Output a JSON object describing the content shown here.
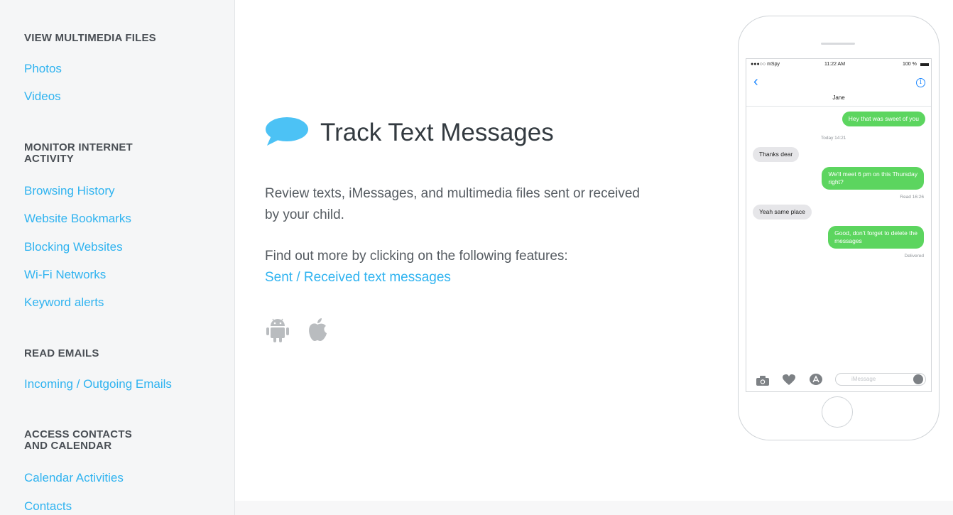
{
  "sidebar": {
    "sections": [
      {
        "title": "VIEW MULTIMEDIA FILES",
        "links": [
          "Photos",
          "Videos"
        ]
      },
      {
        "title": "MONITOR INTERNET\nACTIVITY",
        "links": [
          "Browsing History",
          "Website Bookmarks",
          "Blocking Websites",
          "Wi-Fi Networks",
          "Keyword alerts"
        ]
      },
      {
        "title": "READ EMAILS",
        "links": [
          "Incoming / Outgoing Emails"
        ]
      },
      {
        "title": "ACCESS CONTACTS\nAND CALENDAR",
        "links": [
          "Calendar Activities",
          "Contacts"
        ]
      }
    ]
  },
  "main": {
    "title": "Track Text Messages",
    "description": "Review texts, iMessages, and multimedia files sent or received by your child.",
    "more_text": "Find out more by clicking on the following features:",
    "more_link": "Sent / Received text messages",
    "platform_icons": [
      "android-icon",
      "apple-icon"
    ],
    "accent_color": "#2fb3f0"
  },
  "phone": {
    "status": {
      "carrier": "●●●○○ mSpy",
      "time": "11:22 AM",
      "battery": "100 %"
    },
    "contact": "Jane",
    "messages": [
      {
        "dir": "out",
        "text": "Hey that was sweet of you"
      },
      {
        "dir": "meta",
        "text": "Today 14:21"
      },
      {
        "dir": "in",
        "text": "Thanks dear"
      },
      {
        "dir": "out",
        "text": "We'll meet 6 pm on this Thursday\nright?"
      },
      {
        "dir": "meta",
        "text": "Read 16:26"
      },
      {
        "dir": "in",
        "text": "Yeah same place"
      },
      {
        "dir": "out",
        "text": "Good, don't forget to delete the\nmessages"
      },
      {
        "dir": "meta",
        "text": "Delivered"
      }
    ],
    "input_placeholder": "iMessage",
    "toolbar_icons": [
      "camera-icon",
      "heart-touch-icon",
      "app-store-icon",
      "microphone-icon"
    ],
    "bubble_colors": {
      "outgoing": "#5cd55f",
      "incoming": "#e6e6e9"
    }
  }
}
